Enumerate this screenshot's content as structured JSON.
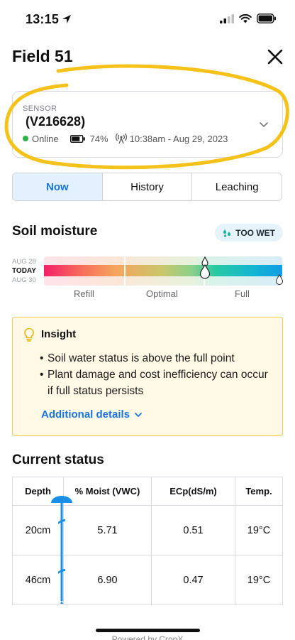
{
  "status_bar": {
    "time": "13:15"
  },
  "header": {
    "title": "Field 51"
  },
  "sensor": {
    "label": "SENSOR",
    "id": "(V216628)",
    "status": "Online",
    "battery": "74%",
    "last_reading": "10:38am - Aug 29, 2023"
  },
  "tabs": [
    {
      "label": "Now",
      "active": true
    },
    {
      "label": "History",
      "active": false
    },
    {
      "label": "Leaching",
      "active": false
    }
  ],
  "soil_moisture": {
    "title": "Soil moisture",
    "badge": "TOO WET",
    "dates": [
      "AUG 28",
      "TODAY",
      "AUG 30"
    ],
    "zones": [
      "Refill",
      "Optimal",
      "Full"
    ]
  },
  "insight": {
    "title": "Insight",
    "bullets": [
      "Soil water status is above the full point",
      "Plant damage and cost inefficiency can occur if full status persists"
    ],
    "link": "Additional details"
  },
  "current_status": {
    "title": "Current status",
    "columns": [
      "Depth",
      "% Moist (VWC)",
      "ECp(dS/m)",
      "Temp."
    ],
    "rows": [
      [
        "20cm",
        "5.71",
        "0.51",
        "19°C"
      ],
      [
        "46cm",
        "6.90",
        "0.47",
        "19°C"
      ]
    ]
  },
  "footer": {
    "powered_by": "Powered by CropX"
  },
  "colors": {
    "accent": "#1a73d9",
    "highlight": "#f5c21a",
    "online": "#2fb14a"
  }
}
